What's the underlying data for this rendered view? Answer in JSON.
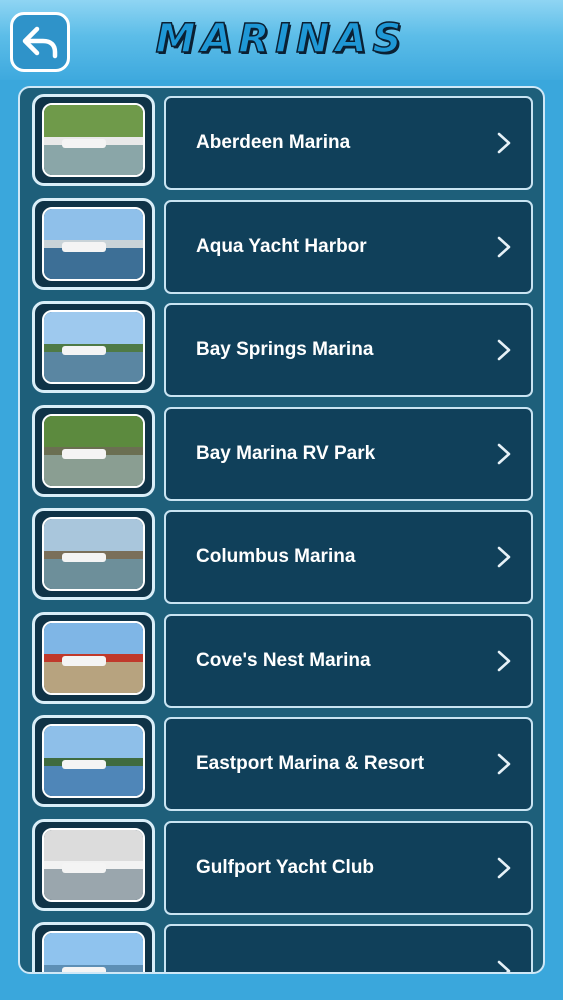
{
  "header": {
    "title": "MARINAS",
    "back_icon": "back-arrow-icon"
  },
  "items": [
    {
      "label": "Aberdeen Marina",
      "photo": {
        "sky": "#6f9a4a",
        "mid": "#e9e9e9",
        "water": "#8aa6a8"
      }
    },
    {
      "label": "Aqua Yacht Harbor",
      "photo": {
        "sky": "#8fc0ea",
        "mid": "#c9d3d8",
        "water": "#3d6f96"
      }
    },
    {
      "label": "Bay Springs Marina",
      "photo": {
        "sky": "#9ec9ee",
        "mid": "#4f7a45",
        "water": "#5a86a2"
      }
    },
    {
      "label": "Bay Marina RV Park",
      "photo": {
        "sky": "#5c8a3e",
        "mid": "#6b6f52",
        "water": "#8a9e92"
      }
    },
    {
      "label": "Columbus Marina",
      "photo": {
        "sky": "#a9c6dc",
        "mid": "#7a6f5a",
        "water": "#6d8f9a"
      }
    },
    {
      "label": "Cove's Nest Marina",
      "photo": {
        "sky": "#7fb6e6",
        "mid": "#c0392b",
        "water": "#b7a37f"
      }
    },
    {
      "label": "Eastport Marina & Resort",
      "photo": {
        "sky": "#8ebfe9",
        "mid": "#3f6b3f",
        "water": "#4f86b8"
      }
    },
    {
      "label": "Gulfport Yacht Club",
      "photo": {
        "sky": "#dcdcdc",
        "mid": "#f2f2f2",
        "water": "#9aa6ad"
      }
    },
    {
      "label": "",
      "photo": {
        "sky": "#8fc3ee",
        "mid": "#5d8fb5",
        "water": "#4f7fa8"
      }
    }
  ],
  "colors": {
    "accent": "#3aa7dc",
    "row_bg": "#10405a",
    "panel_bg": "#1e5f7a"
  },
  "row_icon": "chevron-right-icon"
}
